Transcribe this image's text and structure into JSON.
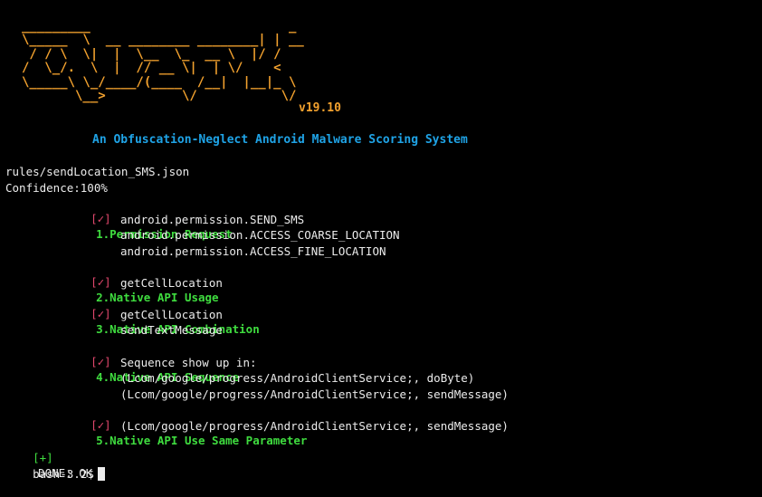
{
  "banner": {
    "ascii_art": "_________                          _\n\\_____  \\  __ ________ ________| | __\n / / \\  \\|  |  \\__  \\_  __ \\  |/ /\n/  \\_/.  \\  |  // __ \\|  | \\/    <\n\\_____\\ \\_/____/(____  /__|  |__|_ \\\n       \\__>          \\/           \\/",
    "version": "v19.10",
    "tagline": "An Obfuscation-Neglect Android Malware Scoring System"
  },
  "output": {
    "rule_file": "rules/sendLocation_SMS.json",
    "confidence": "Confidence:100%",
    "check_mark": "[✓]",
    "sections": [
      {
        "title": "1.Permission Request",
        "details": [
          "android.permission.SEND_SMS",
          "android.permission.ACCESS_COARSE_LOCATION",
          "android.permission.ACCESS_FINE_LOCATION"
        ]
      },
      {
        "title": "2.Native API Usage",
        "details": [
          "getCellLocation"
        ]
      },
      {
        "title": "3.Native API Combination",
        "details": [
          "getCellLocation",
          "sendTextMessage"
        ]
      },
      {
        "title": "4.Native API Sequence",
        "details": [
          "Sequence show up in:",
          "(Lcom/google/progress/AndroidClientService;, doByte)",
          "(Lcom/google/progress/AndroidClientService;, sendMessage)"
        ]
      },
      {
        "title": "5.Native API Use Same Parameter",
        "details": [
          "(Lcom/google/progress/AndroidClientService;, sendMessage)"
        ]
      }
    ],
    "done_marker": "[+]",
    "done_text": "DONE: OK"
  },
  "prompt": {
    "text": "bash-3.2$"
  },
  "colors": {
    "background": "#000000",
    "banner": "#f2a12e",
    "tagline": "#1fa3e6",
    "section": "#3fdc3f",
    "check": "#e0476c",
    "text": "#ececec"
  }
}
